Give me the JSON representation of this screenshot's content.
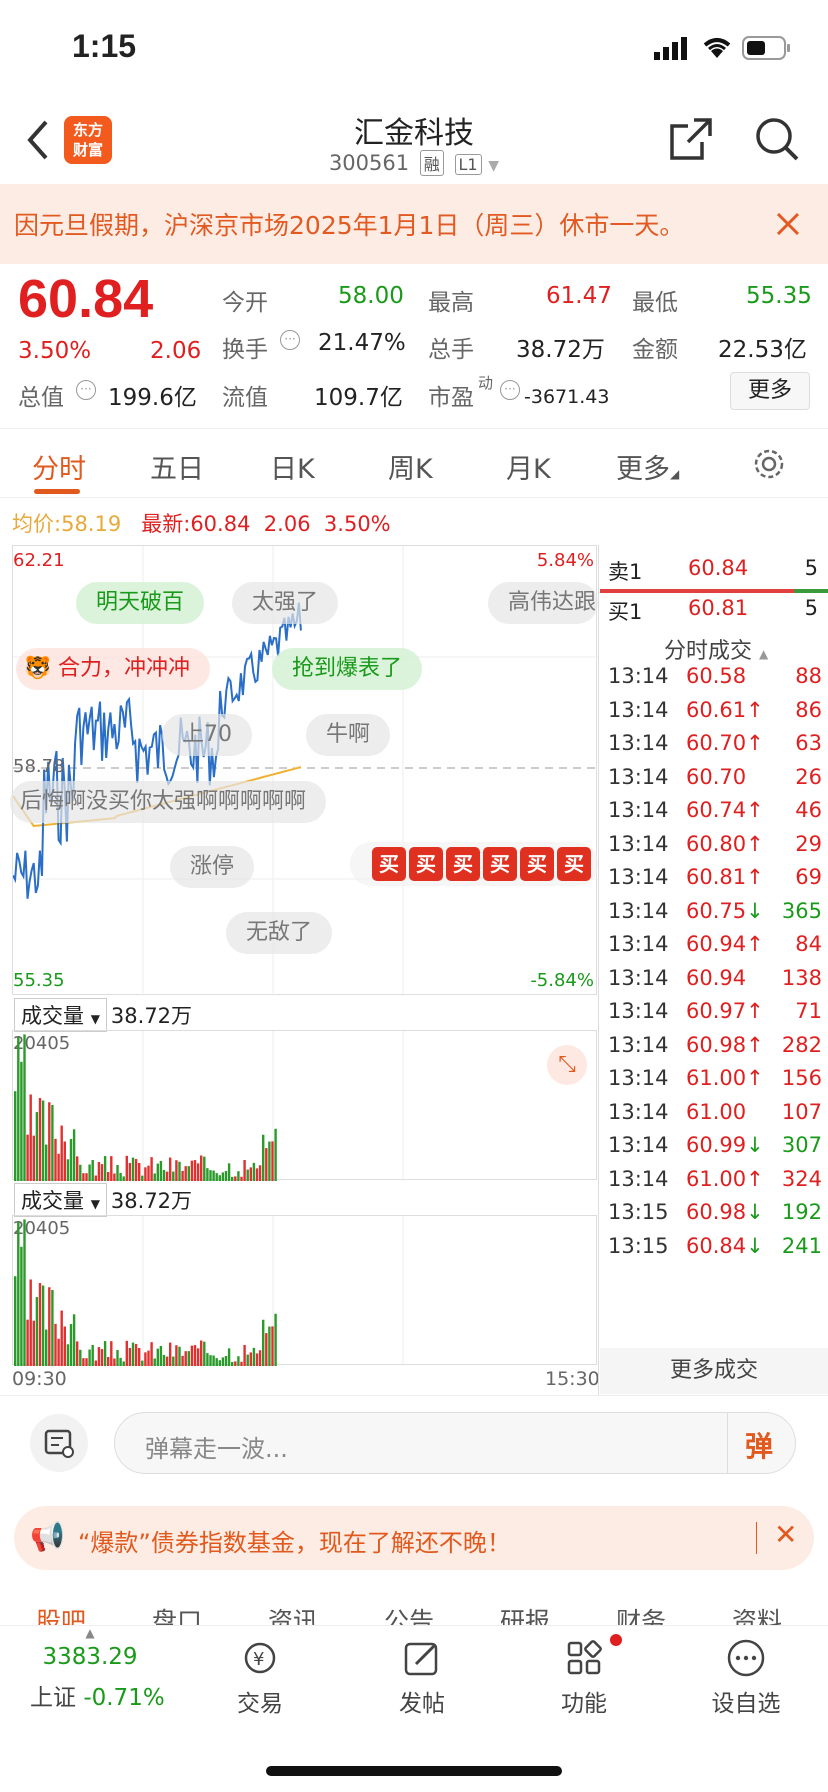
{
  "status": {
    "time": "1:15"
  },
  "header": {
    "title": "汇金科技",
    "code": "300561",
    "tag_margin": "融",
    "tag_level": "L1",
    "logo_line1": "东方",
    "logo_line2": "财富"
  },
  "notice": {
    "text": "因元旦假期，沪深京市场2025年1月1日（周三）休市一天。"
  },
  "quote": {
    "price": "60.84",
    "change_pct": "3.50%",
    "change": "2.06",
    "open_label": "今开",
    "open": "58.00",
    "high_label": "最高",
    "high": "61.47",
    "low_label": "最低",
    "low": "55.35",
    "turnover_label": "换手",
    "turnover": "21.47%",
    "volume_label": "总手",
    "volume": "38.72万",
    "amount_label": "金额",
    "amount": "22.53亿",
    "mcap_label": "总值",
    "mcap": "199.6亿",
    "float_label": "流值",
    "float": "109.7亿",
    "pe_label": "市盈",
    "pe_sup": "动",
    "pe": "-3671.43",
    "more": "更多"
  },
  "tabs": [
    "分时",
    "五日",
    "日K",
    "周K",
    "月K",
    "更多"
  ],
  "chart": {
    "avg_label": "均价:",
    "avg": "58.19",
    "latest_label": "最新:",
    "latest": "60.84",
    "chg": "2.06",
    "pct": "3.50%",
    "ymax": "62.21",
    "ymin": "55.35",
    "pmax": "5.84%",
    "pmin": "-5.84%",
    "base": "58.78",
    "t_start": "09:30",
    "t_end": "15:30",
    "vol_label": "成交量",
    "vol_total": "38.72万",
    "vol_max": "20405"
  },
  "danmu": [
    "明天破百",
    "太强了",
    "高伟达跟",
    "合力，冲冲冲",
    "抢到爆表了",
    "上70",
    "牛啊",
    "后悔啊没买你太强啊啊啊啊啊",
    "涨停",
    "无敌了"
  ],
  "buy_badge": "买",
  "orderbook": {
    "sell_label": "卖1",
    "sell_price": "60.84",
    "sell_vol": "5",
    "buy_label": "买1",
    "buy_price": "60.81",
    "buy_vol": "5"
  },
  "trades_header": "分时成交",
  "trades": [
    {
      "t": "13:14",
      "p": "60.58",
      "a": "",
      "v": "88"
    },
    {
      "t": "13:14",
      "p": "60.61",
      "a": "↑",
      "v": "86"
    },
    {
      "t": "13:14",
      "p": "60.70",
      "a": "↑",
      "v": "63"
    },
    {
      "t": "13:14",
      "p": "60.70",
      "a": "",
      "v": "26"
    },
    {
      "t": "13:14",
      "p": "60.74",
      "a": "↑",
      "v": "46"
    },
    {
      "t": "13:14",
      "p": "60.80",
      "a": "↑",
      "v": "29"
    },
    {
      "t": "13:14",
      "p": "60.81",
      "a": "↑",
      "v": "69"
    },
    {
      "t": "13:14",
      "p": "60.75",
      "a": "↓",
      "v": "365"
    },
    {
      "t": "13:14",
      "p": "60.94",
      "a": "↑",
      "v": "84"
    },
    {
      "t": "13:14",
      "p": "60.94",
      "a": "",
      "v": "138"
    },
    {
      "t": "13:14",
      "p": "60.97",
      "a": "↑",
      "v": "71"
    },
    {
      "t": "13:14",
      "p": "60.98",
      "a": "↑",
      "v": "282"
    },
    {
      "t": "13:14",
      "p": "61.00",
      "a": "↑",
      "v": "156"
    },
    {
      "t": "13:14",
      "p": "61.00",
      "a": "",
      "v": "107"
    },
    {
      "t": "13:14",
      "p": "60.99",
      "a": "↓",
      "v": "307"
    },
    {
      "t": "13:14",
      "p": "61.00",
      "a": "↑",
      "v": "324"
    },
    {
      "t": "13:15",
      "p": "60.98",
      "a": "↓",
      "v": "192"
    },
    {
      "t": "13:15",
      "p": "60.84",
      "a": "↓",
      "v": "241"
    }
  ],
  "more_trades": "更多成交",
  "comment": {
    "placeholder": "弹幕走一波...",
    "btn": "弹"
  },
  "ad": {
    "text": "“爆款”债券指数基金，现在了解还不晚！"
  },
  "bottom_tabs": [
    "股吧",
    "盘口",
    "资讯",
    "公告",
    "研报",
    "财务",
    "资料"
  ],
  "nav": {
    "index_value": "3383.29",
    "index_name": "上证",
    "index_change": "-0.71%",
    "trade": "交易",
    "post": "发帖",
    "func": "功能",
    "watch": "设自选"
  }
}
